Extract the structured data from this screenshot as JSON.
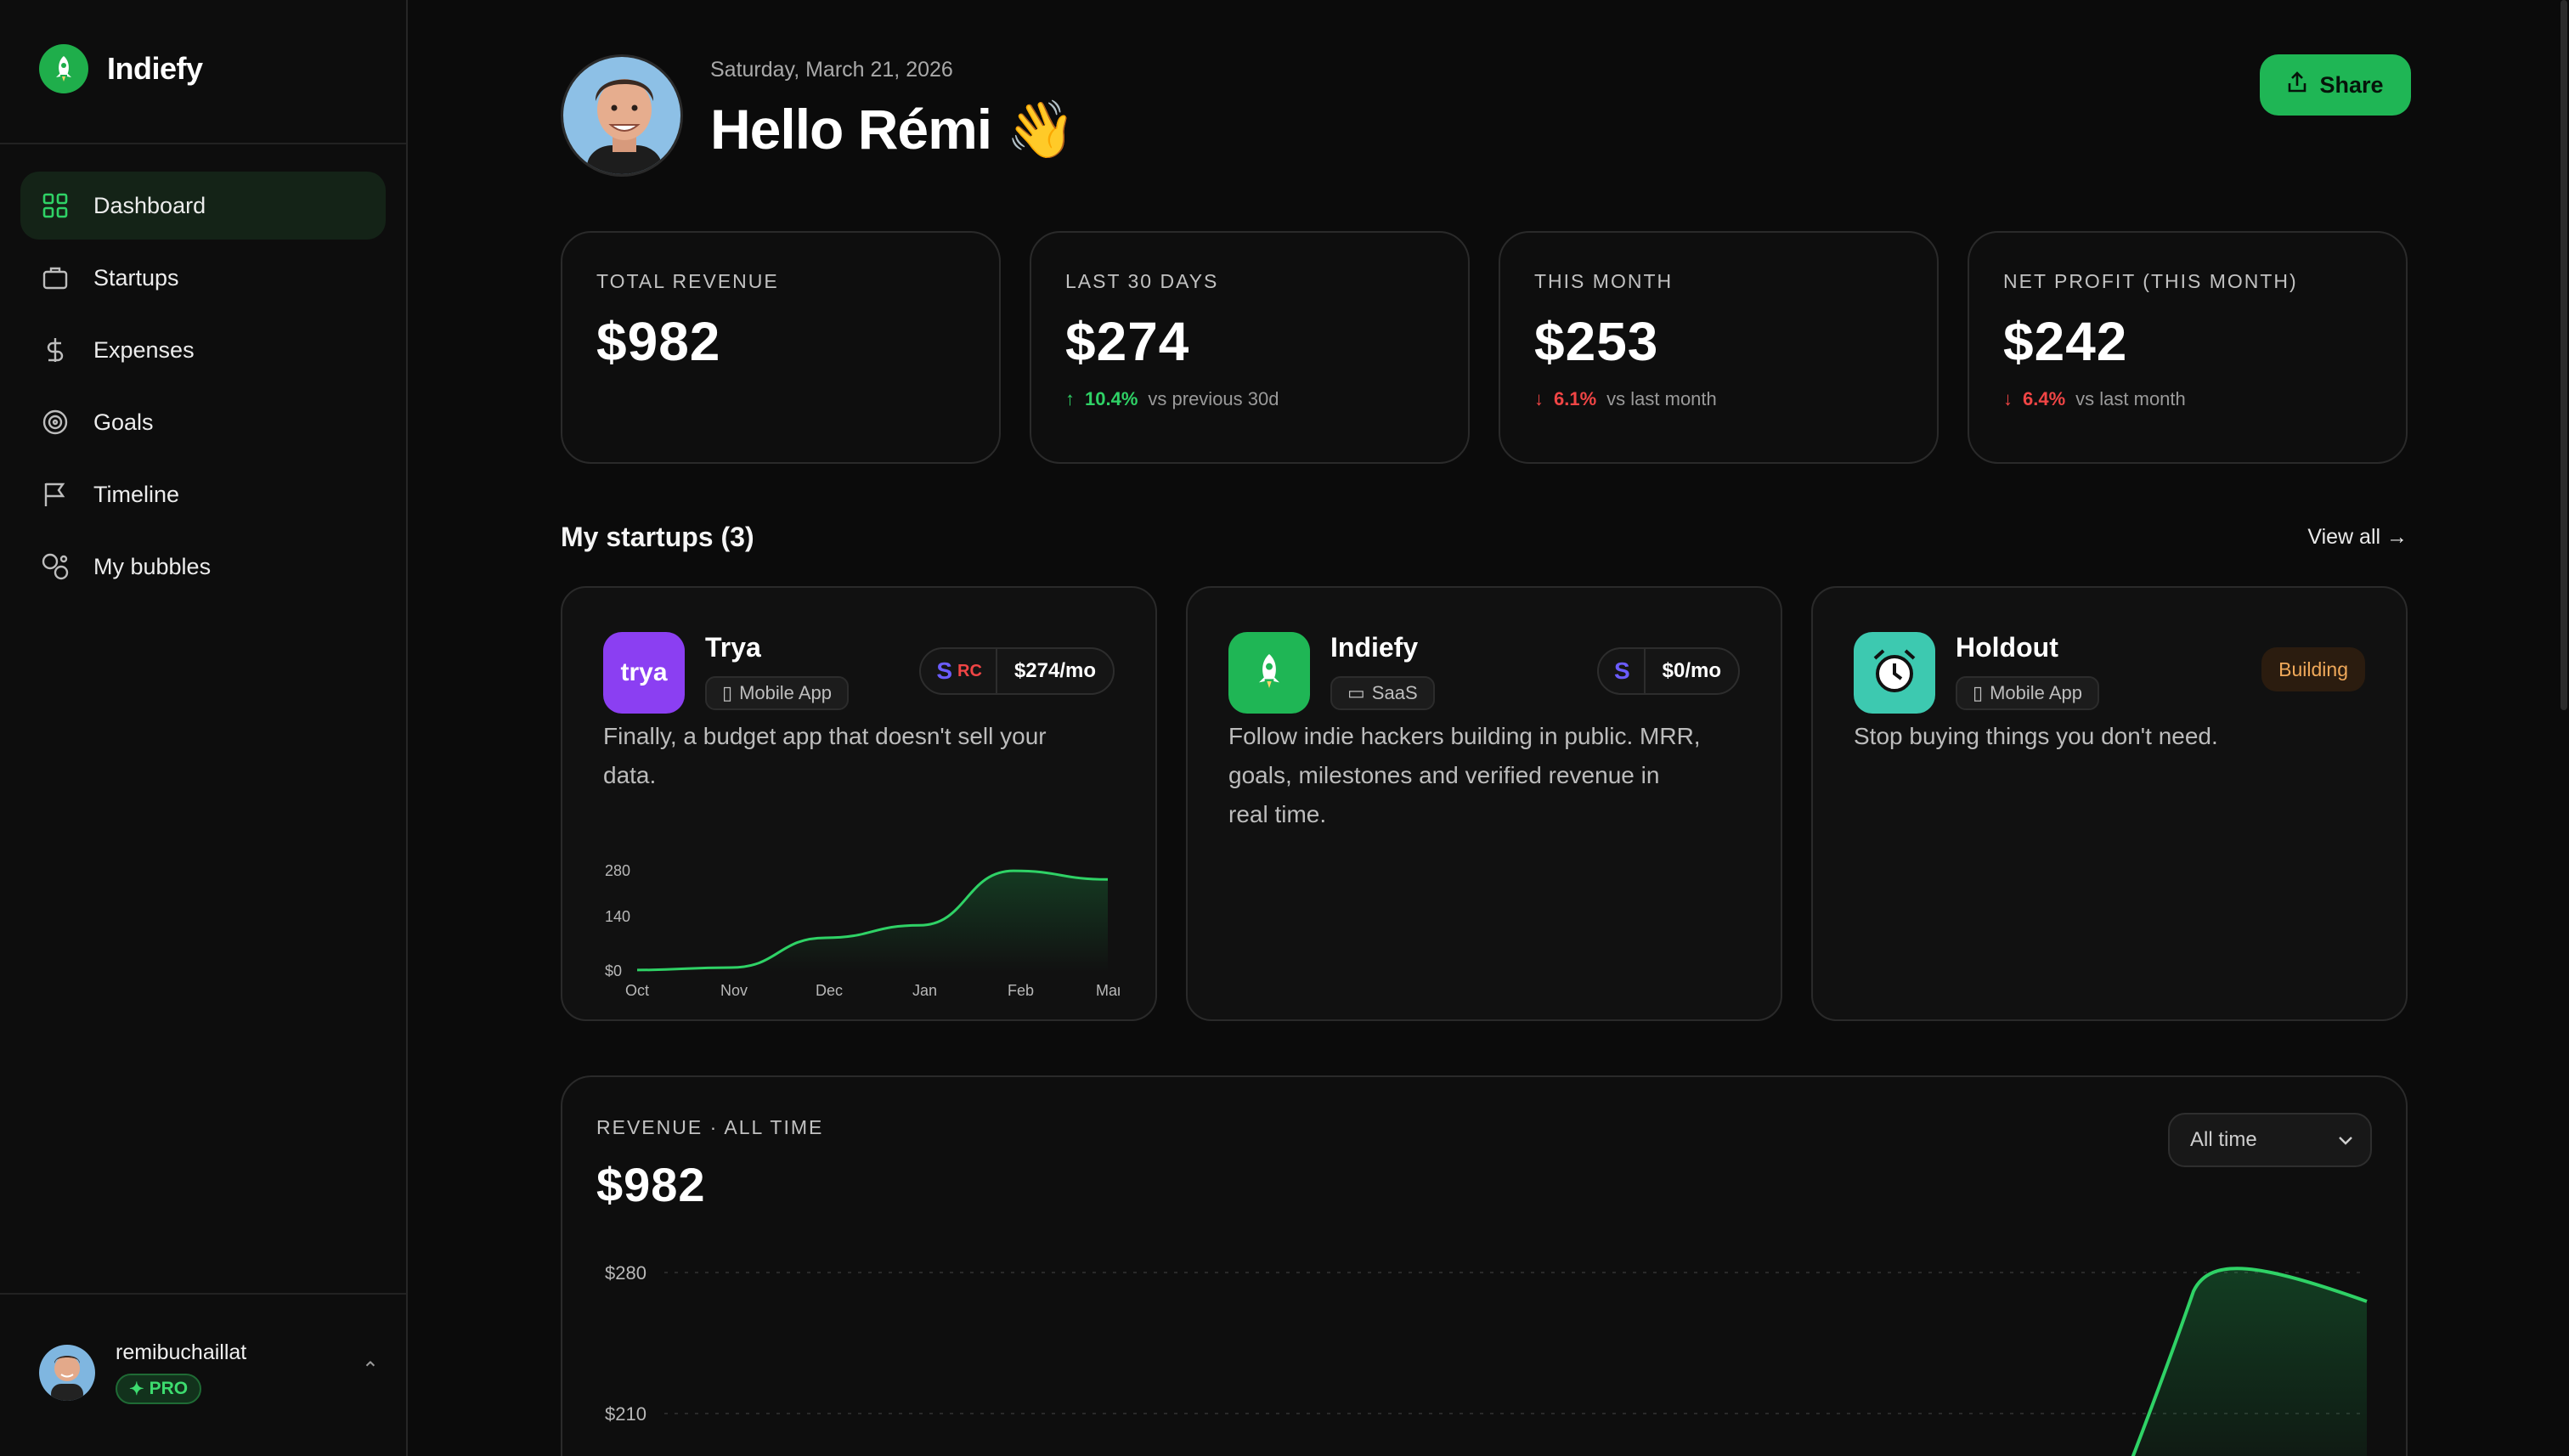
{
  "brand": {
    "name": "Indiefy"
  },
  "sidebar": {
    "items": [
      {
        "label": "Dashboard",
        "icon": "grid-icon",
        "active": true
      },
      {
        "label": "Startups",
        "icon": "briefcase-icon"
      },
      {
        "label": "Expenses",
        "icon": "dollar-icon"
      },
      {
        "label": "Goals",
        "icon": "target-icon"
      },
      {
        "label": "Timeline",
        "icon": "flag-icon"
      },
      {
        "label": "My bubbles",
        "icon": "bubbles-icon"
      }
    ],
    "user": {
      "name": "remibuchaillat",
      "badge": "PRO"
    }
  },
  "header": {
    "date": "Saturday, March 21, 2026",
    "greeting": "Hello Rémi 👋",
    "share_label": "Share"
  },
  "stats": [
    {
      "label": "TOTAL REVENUE",
      "value": "$982",
      "delta": "",
      "delta_text": ""
    },
    {
      "label": "LAST 30 DAYS",
      "value": "$274",
      "delta": "10.4%",
      "delta_dir": "up",
      "delta_text": "vs previous 30d"
    },
    {
      "label": "THIS MONTH",
      "value": "$253",
      "delta": "6.1%",
      "delta_dir": "down",
      "delta_text": "vs last month"
    },
    {
      "label": "NET PROFIT (THIS MONTH)",
      "value": "$242",
      "delta": "6.4%",
      "delta_dir": "down",
      "delta_text": "vs last month"
    }
  ],
  "startups_section": {
    "title": "My startups (3)",
    "view_all": "View all →"
  },
  "startups": [
    {
      "name": "Trya",
      "logo_text": "trya",
      "tag": "Mobile App",
      "revenue": "$274/mo",
      "description": "Finally, a budget app that doesn't sell your data.",
      "chart": {
        "y_ticks": [
          "280",
          "140",
          "$0"
        ],
        "x_ticks": [
          "Oct",
          "Nov",
          "Dec",
          "Jan",
          "Feb",
          "Mar"
        ]
      }
    },
    {
      "name": "Indiefy",
      "tag": "SaaS",
      "revenue": "$0/mo",
      "description": "Follow indie hackers building in public. MRR, goals, milestones and verified revenue in real time."
    },
    {
      "name": "Holdout",
      "tag": "Mobile App",
      "status": "Building",
      "description": "Stop buying things you don't need."
    }
  ],
  "revenue_card": {
    "label": "REVENUE · ALL TIME",
    "value": "$982",
    "range_select": "All time",
    "y_ticks": [
      "$280",
      "$210"
    ]
  },
  "chart_data": {
    "type": "area",
    "x": [
      "Oct",
      "Nov",
      "Dec",
      "Jan",
      "Feb",
      "Mar"
    ],
    "series": [
      {
        "values": [
          5,
          12,
          95,
          130,
          282,
          258
        ]
      }
    ],
    "ylim": [
      0,
      280
    ]
  },
  "colors": {
    "accent": "#1fb655",
    "up": "#2fd266",
    "down": "#f04545",
    "building": "#f0a95a"
  }
}
